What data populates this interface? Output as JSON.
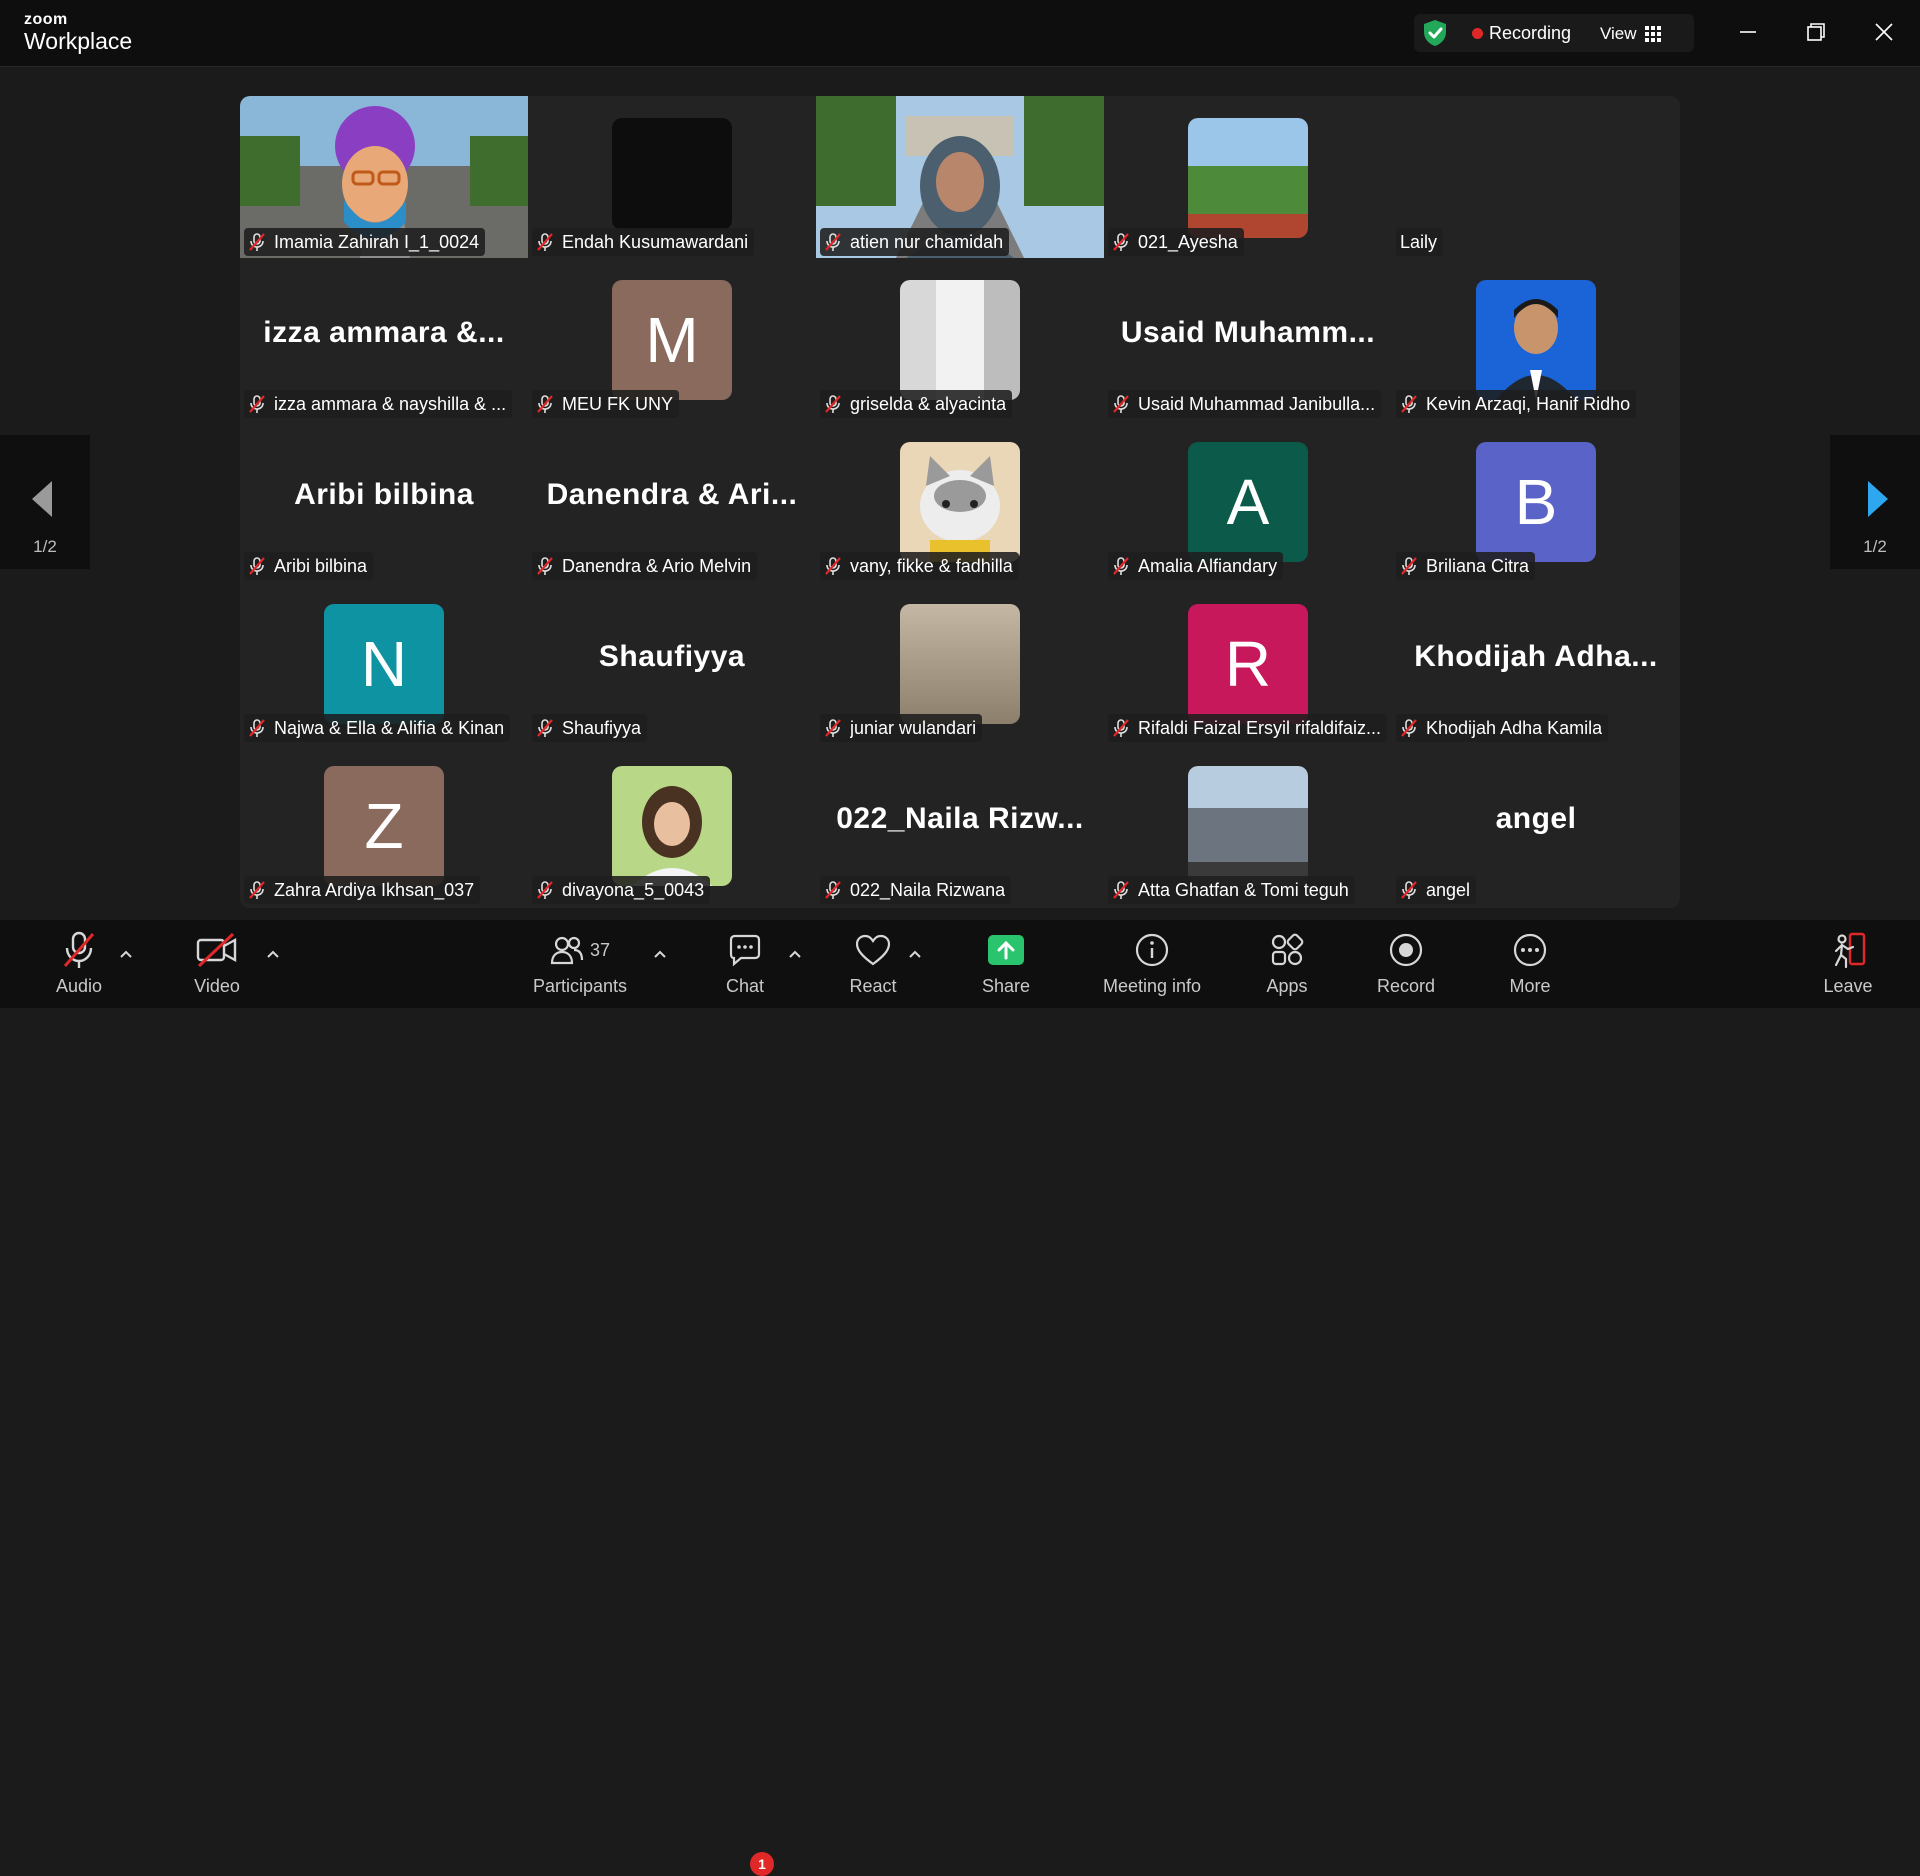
{
  "app": {
    "brand_top": "zoom",
    "brand_bottom": "Workplace"
  },
  "header": {
    "recording_label": "Recording",
    "view_label": "View"
  },
  "pagination": {
    "left": "1/2",
    "right": "1/2"
  },
  "tiles": [
    {
      "name": "Imamia Zahirah I_1_0024",
      "kind": "video-avatar"
    },
    {
      "name": "Endah Kusumawardani",
      "kind": "dark-photo"
    },
    {
      "name": "atien nur chamidah",
      "kind": "video-person",
      "active": true
    },
    {
      "name": "021_Ayesha",
      "kind": "photo-park"
    },
    {
      "name": "Laily",
      "kind": "empty",
      "muted": false
    },
    {
      "name": "izza ammara & nayshilla & ...",
      "bigname": "izza ammara &...",
      "kind": "text"
    },
    {
      "name": "MEU FK UNY",
      "kind": "letter",
      "letter": "M",
      "color": "#8a6a5c"
    },
    {
      "name": "griselda & alyacinta",
      "kind": "photo-fridge"
    },
    {
      "name": "Usaid Muhammad Janibulla...",
      "bigname": "Usaid Muhamm...",
      "kind": "text"
    },
    {
      "name": "Kevin Arzaqi, Hanif Ridho",
      "kind": "photo-portrait"
    },
    {
      "name": "Aribi bilbina",
      "bigname": "Aribi bilbina",
      "kind": "text"
    },
    {
      "name": "Danendra & Ario Melvin",
      "bigname": "Danendra & Ari...",
      "kind": "text"
    },
    {
      "name": "vany, fikke & fadhilla",
      "kind": "photo-cat"
    },
    {
      "name": "Amalia Alfiandary",
      "kind": "letter",
      "letter": "A",
      "color": "#0b5a4a"
    },
    {
      "name": "Briliana Citra",
      "kind": "letter",
      "letter": "B",
      "color": "#5a63c7"
    },
    {
      "name": "Najwa & Ella & Alifia & Kinan",
      "kind": "letter",
      "letter": "N",
      "color": "#0e93a3"
    },
    {
      "name": "Shaufiyya",
      "bigname": "Shaufiyya",
      "kind": "text"
    },
    {
      "name": "juniar wulandari",
      "kind": "photo-wood"
    },
    {
      "name": "Rifaldi Faizal Ersyil rifaldifaiz...",
      "kind": "letter",
      "letter": "R",
      "color": "#c8185c"
    },
    {
      "name": "Khodijah Adha Kamila",
      "bigname": "Khodijah Adha...",
      "kind": "text"
    },
    {
      "name": "Zahra Ardiya Ikhsan_037",
      "kind": "letter",
      "letter": "Z",
      "color": "#8a6a5c"
    },
    {
      "name": "divayona_5_0043",
      "kind": "photo-hijab"
    },
    {
      "name": "022_Naila Rizwana",
      "bigname": "022_Naila Rizw...",
      "kind": "text"
    },
    {
      "name": "Atta Ghatfan & Tomi teguh",
      "kind": "photo-building"
    },
    {
      "name": "angel",
      "bigname": "angel",
      "kind": "text"
    }
  ],
  "toolbar": {
    "audio": "Audio",
    "video": "Video",
    "participants": "Participants",
    "participants_count": "37",
    "chat": "Chat",
    "chat_badge": "1",
    "react": "React",
    "share": "Share",
    "meeting_info": "Meeting info",
    "apps": "Apps",
    "record": "Record",
    "more": "More",
    "leave": "Leave"
  },
  "colors": {
    "active_speaker": "#30d67c",
    "share_green": "#2bc46e",
    "recording_red": "#e02828",
    "shield_green": "#23a85a"
  }
}
